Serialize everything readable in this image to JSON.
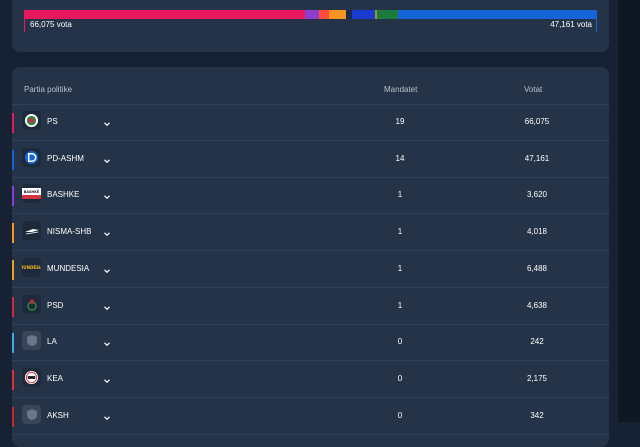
{
  "seat_bar": {
    "segments": [
      {
        "party": "PS",
        "color": "#e8185e",
        "fraction": 0.49
      },
      {
        "party": "purple",
        "color": "#8a3fd1",
        "fraction": 0.025
      },
      {
        "party": "orange-red",
        "color": "#ff4d3a",
        "fraction": 0.017
      },
      {
        "party": "orange",
        "color": "#f7931e",
        "fraction": 0.03
      },
      {
        "party": "navy",
        "color": "#1a2a4a",
        "fraction": 0.01
      },
      {
        "party": "blue",
        "color": "#1a3ad1",
        "fraction": 0.04
      },
      {
        "party": "olive",
        "color": "#8aa020",
        "fraction": 0.005
      },
      {
        "party": "green",
        "color": "#1e7a3c",
        "fraction": 0.035
      },
      {
        "party": "PD-ASHM",
        "color": "#1565d8",
        "fraction": 0.348
      }
    ],
    "left_label": "66,075 vota",
    "right_label": "47,161 vota",
    "left_color": "#e8185e",
    "right_color": "#1565d8"
  },
  "table": {
    "headers": {
      "party": "Partia politike",
      "seats": "Mandatet",
      "votes": "Votat"
    },
    "rows": [
      {
        "name": "PS",
        "seats": "19",
        "votes": "66,075",
        "color": "#e8185e",
        "icon": "ps-logo-icon"
      },
      {
        "name": "PD-ASHM",
        "seats": "14",
        "votes": "47,161",
        "color": "#1565d8",
        "icon": "pd-logo-icon"
      },
      {
        "name": "BASHKE",
        "seats": "1",
        "votes": "3,620",
        "color": "#8a3fd1",
        "icon": "bashke-logo-icon"
      },
      {
        "name": "NISMA-SHB",
        "seats": "1",
        "votes": "4,018",
        "color": "#f7931e",
        "icon": "nisma-logo-icon"
      },
      {
        "name": "MUNDESIA",
        "seats": "1",
        "votes": "6,488",
        "color": "#e8a21c",
        "icon": "mundesia-logo-icon"
      },
      {
        "name": "PSD",
        "seats": "1",
        "votes": "4,638",
        "color": "#d6283d",
        "icon": "psd-logo-icon"
      },
      {
        "name": "LA",
        "seats": "0",
        "votes": "242",
        "color": "#3fa9e0",
        "icon": "shield-placeholder-icon"
      },
      {
        "name": "KEA",
        "seats": "0",
        "votes": "2,175",
        "color": "#e0303a",
        "icon": "kea-logo-icon"
      },
      {
        "name": "AKSH",
        "seats": "0",
        "votes": "342",
        "color": "#c62828",
        "icon": "shield-placeholder-icon"
      }
    ]
  },
  "logo_text": {
    "bashke": "BASHKË",
    "mundesia": "MUNDËSIA"
  }
}
